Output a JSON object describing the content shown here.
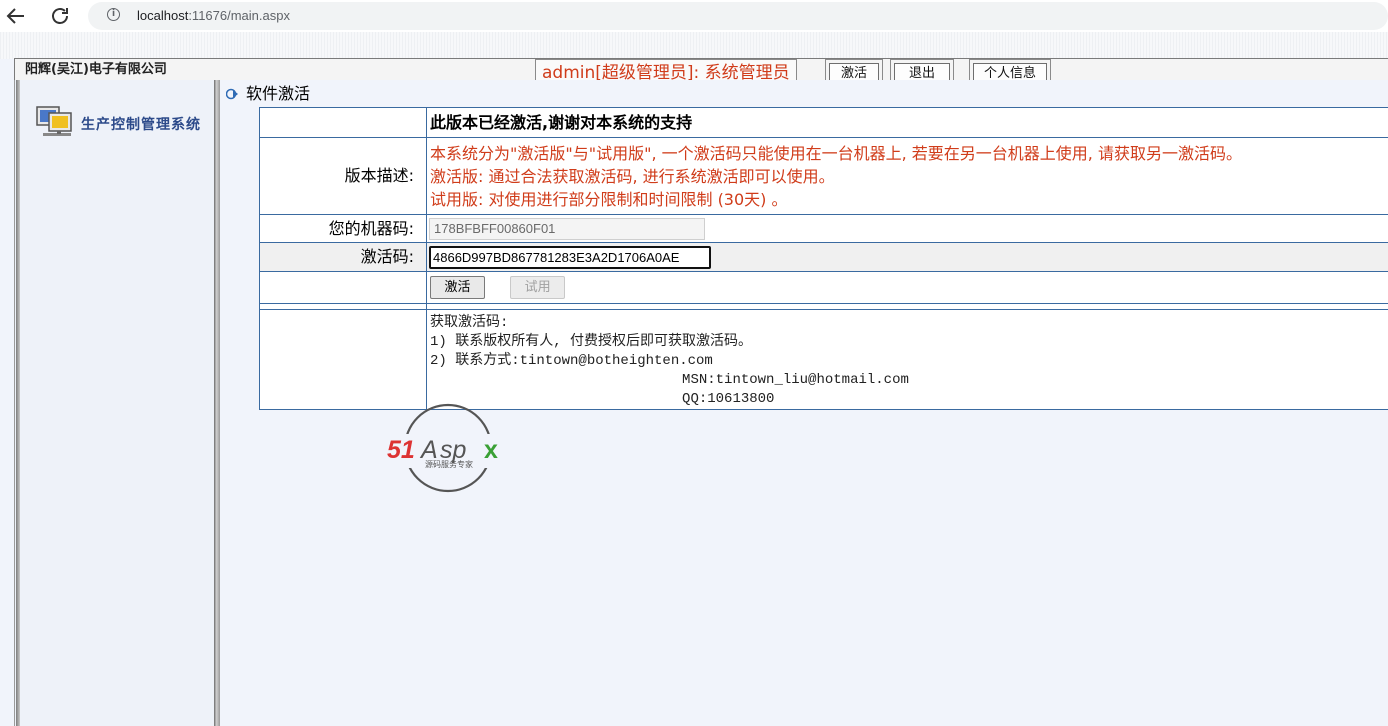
{
  "browser": {
    "url_host": "localhost",
    "url_rest": ":11676/main.aspx"
  },
  "header": {
    "company": "阳辉(吴江)电子有限公司",
    "user_info": "admin[超级管理员]: 系统管理员",
    "buttons": {
      "activate": "激活",
      "logout": "退出",
      "profile": "个人信息"
    }
  },
  "sidebar": {
    "system_title": "生产控制管理系统",
    "logo_icon": "computer-monitor-icon"
  },
  "page": {
    "heading": "软件激活"
  },
  "form": {
    "title": "此版本已经激活,谢谢对本系统的支持",
    "desc_label": "版本描述:",
    "desc_lines": [
      "本系统分为\"激活版\"与\"试用版\", 一个激活码只能使用在一台机器上, 若要在另一台机器上使用, 请获取另一激活码。",
      "激活版: 通过合法获取激活码, 进行系统激活即可以使用。",
      "试用版: 对使用进行部分限制和时间限制 (30天) 。"
    ],
    "machine_code_label": "您的机器码:",
    "machine_code_value": "178BFBFF00860F01",
    "activation_label": "激活码:",
    "activation_value": "4866D997BD867781283E3A2D1706A0AE",
    "activate_button": "激活",
    "trial_button": "试用",
    "info_text": "获取激活码:\n1) 联系版权所有人, 付费授权后即可获取激活码。\n2) 联系方式:tintown@botheighten.com\n                              MSN:tintown_liu@hotmail.com\n                              QQ:10613800"
  },
  "watermark": {
    "brand": "51Aspx",
    "tagline": "源码服务专家"
  },
  "colors": {
    "desc_red": "#d03c1a",
    "table_border": "#3a6aa0",
    "sidebar_title": "#2c4a8a"
  }
}
